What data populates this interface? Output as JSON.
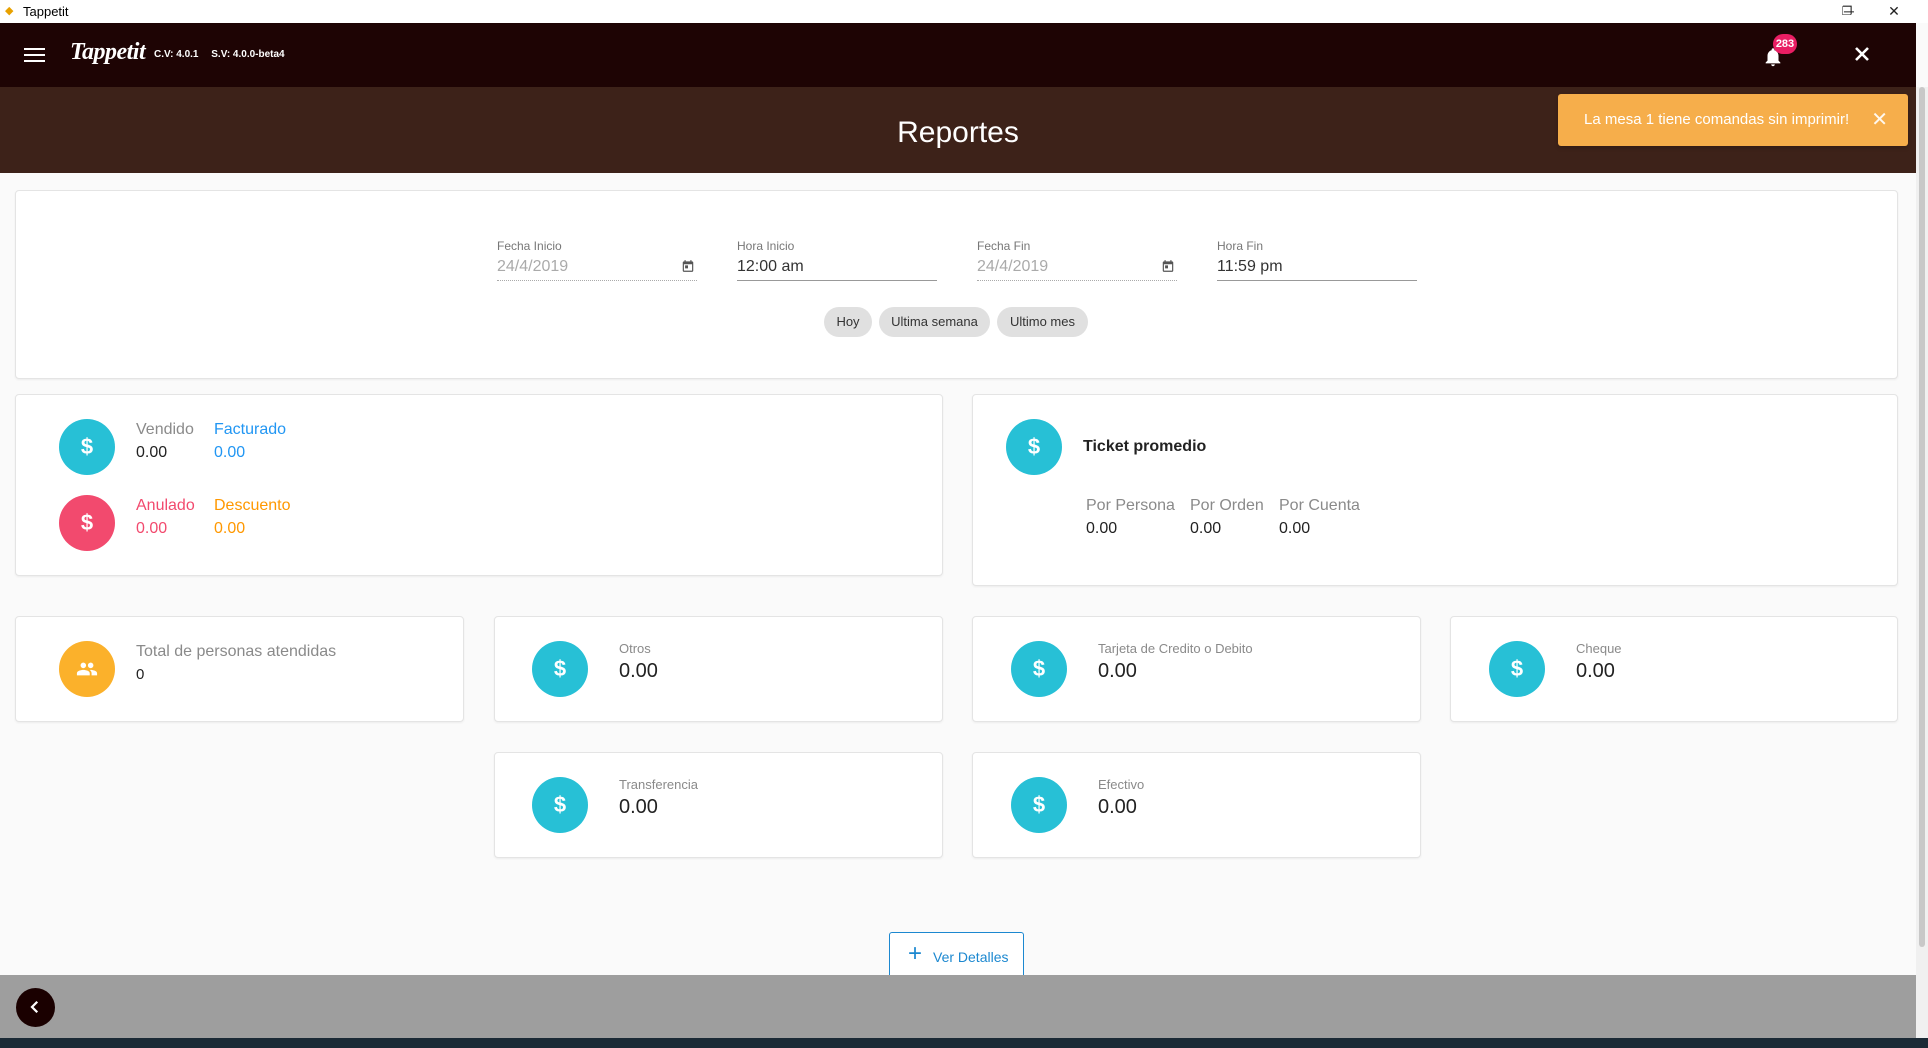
{
  "window": {
    "title": "Tappetit",
    "minimize_glyph": "─",
    "restore_glyph": "❐",
    "close_glyph": "✕"
  },
  "header": {
    "logo": "Tappetit",
    "client_version": "C.V: 4.0.1",
    "server_version": "S.V: 4.0.0-beta4",
    "notification_count": "283"
  },
  "page": {
    "title": "Reportes"
  },
  "toast": {
    "message": "La mesa 1 tiene comandas sin imprimir!",
    "close_glyph": "✕"
  },
  "filters": {
    "start_date": {
      "label": "Fecha Inicio",
      "value": "24/4/2019"
    },
    "start_time": {
      "label": "Hora Inicio",
      "value": "12:00 am"
    },
    "end_date": {
      "label": "Fecha Fin",
      "value": "24/4/2019"
    },
    "end_time": {
      "label": "Hora Fin",
      "value": "11:59 pm"
    },
    "chips": [
      "Hoy",
      "Ultima semana",
      "Ultimo mes"
    ]
  },
  "sales": {
    "vendido": {
      "label": "Vendido",
      "value": "0.00"
    },
    "facturado": {
      "label": "Facturado",
      "value": "0.00"
    },
    "anulado": {
      "label": "Anulado",
      "value": "0.00"
    },
    "descuento": {
      "label": "Descuento",
      "value": "0.00"
    }
  },
  "ticket": {
    "title": "Ticket promedio",
    "por_persona": {
      "label": "Por Persona",
      "value": "0.00"
    },
    "por_orden": {
      "label": "Por Orden",
      "value": "0.00"
    },
    "por_cuenta": {
      "label": "Por Cuenta",
      "value": "0.00"
    }
  },
  "people": {
    "label": "Total de personas atendidas",
    "value": "0"
  },
  "payments": {
    "otros": {
      "label": "Otros",
      "value": "0.00"
    },
    "tarjeta": {
      "label": "Tarjeta de Credito o Debito",
      "value": "0.00"
    },
    "cheque": {
      "label": "Cheque",
      "value": "0.00"
    },
    "transferencia": {
      "label": "Transferencia",
      "value": "0.00"
    },
    "efectivo": {
      "label": "Efectivo",
      "value": "0.00"
    }
  },
  "icons": {
    "currency": "$"
  },
  "details_button": {
    "label": "Ver Detalles"
  },
  "colors": {
    "header_bg": "#1e0404",
    "title_band_bg": "#3d2219",
    "teal": "#27c0d6",
    "pink": "#f24a6e",
    "amber": "#fbb12b",
    "toast_bg": "#f6ae4b",
    "link_blue": "#2196f3",
    "anulado": "#f24a6e",
    "descuento": "#ff9800"
  }
}
